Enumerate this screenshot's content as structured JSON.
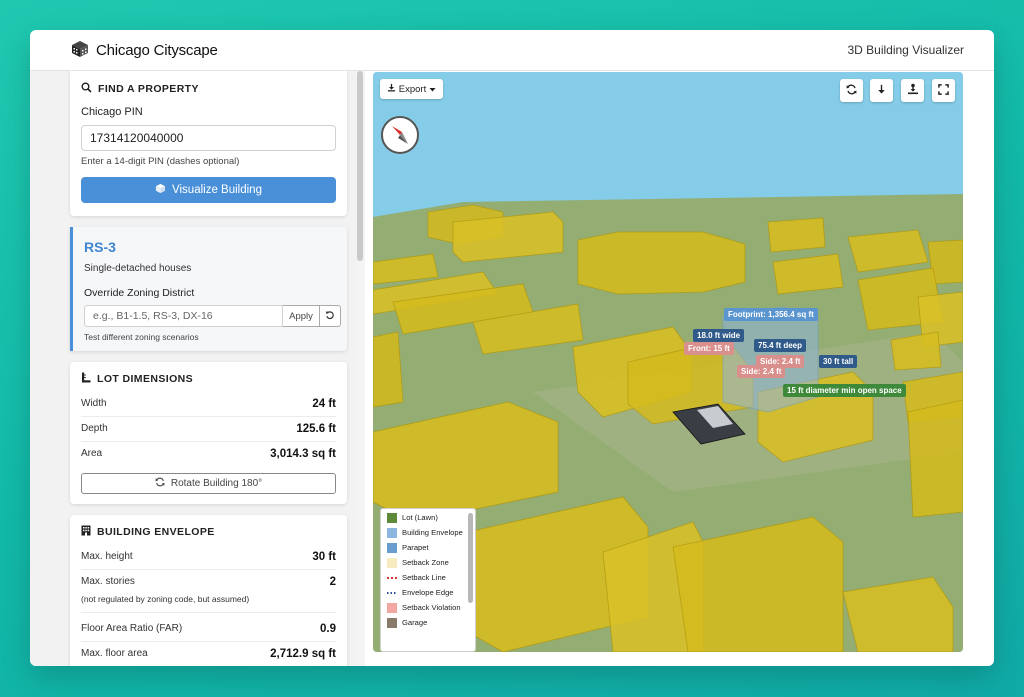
{
  "app": {
    "brand": "Chicago Cityscape",
    "tagline": "3D Building Visualizer"
  },
  "find_property": {
    "header": "FIND A PROPERTY",
    "pin_label": "Chicago PIN",
    "pin_value": "17314120040000",
    "pin_help": "Enter a 14-digit PIN (dashes optional)",
    "visualize_button": "Visualize Building"
  },
  "zoning": {
    "code": "RS-3",
    "description": "Single-detached houses",
    "override_label": "Override Zoning District",
    "override_placeholder": "e.g., B1-1.5, RS-3, DX-16",
    "apply_button": "Apply",
    "override_help": "Test different zoning scenarios"
  },
  "lot_dimensions": {
    "header": "LOT DIMENSIONS",
    "rows": [
      {
        "label": "Width",
        "value": "24 ft"
      },
      {
        "label": "Depth",
        "value": "125.6 ft"
      },
      {
        "label": "Area",
        "value": "3,014.3 sq ft"
      }
    ],
    "rotate_button": "Rotate Building 180°"
  },
  "building_envelope": {
    "header": "BUILDING ENVELOPE",
    "max_height_label": "Max. height",
    "max_height_value": "30 ft",
    "max_stories_label": "Max. stories",
    "max_stories_value": "2",
    "max_stories_note": "(not regulated by zoning code, but assumed)",
    "far_label": "Floor Area Ratio (FAR)",
    "far_value": "0.9",
    "max_floor_area_label": "Max. floor area",
    "max_floor_area_value": "2,712.9 sq ft"
  },
  "viewer": {
    "export_button": "Export",
    "tools": [
      "refresh-icon",
      "download-arrow-icon",
      "ground-pin-icon",
      "fullscreen-icon"
    ],
    "annotations": {
      "footprint": "Footprint: 1,356.4 sq ft",
      "width": "18.0 ft wide",
      "front": "Front: 15 ft",
      "depth": "75.4 ft deep",
      "side_a": "Side: 2.4 ft",
      "side_b": "Side: 2.4 ft",
      "height": "30 ft tall",
      "open_space": "15 ft diameter min open space"
    },
    "legend": [
      {
        "label": "Lot (Lawn)",
        "color": "#5f8a3a"
      },
      {
        "label": "Building Envelope",
        "color": "#8fb6e0"
      },
      {
        "label": "Parapet",
        "color": "#6b9ccf"
      },
      {
        "label": "Setback Zone",
        "color": "#f7ecc0"
      },
      {
        "label": "Setback Line",
        "color": "#d9302c"
      },
      {
        "label": "Envelope Edge",
        "color": "#2b4f9c"
      },
      {
        "label": "Setback Violation",
        "color": "#f0a7a0"
      },
      {
        "label": "Garage",
        "color": "#8a7a6a"
      }
    ],
    "colors": {
      "sky": "#85cce8",
      "ground": "#94ad72",
      "neighbor_building": "#d4bb1e",
      "annotation_blue": "#5b95cf",
      "annotation_navy": "#2f5a8a",
      "annotation_red": "#d98f8c",
      "annotation_green": "#3f8a3a"
    }
  }
}
